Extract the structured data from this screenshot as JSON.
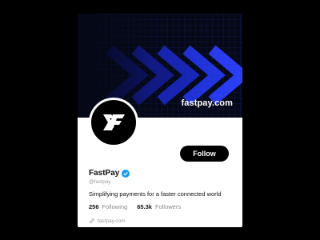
{
  "colors": {
    "page_bg": "#000000",
    "banner_bg": "#050816",
    "arrow_blue": "#2b3fff",
    "verified_blue": "#1d9bf0",
    "button_bg": "#000000",
    "text_muted": "#9a9a9a"
  },
  "banner": {
    "url_text": "fastpay.com",
    "decoration": "arrows-icon"
  },
  "avatar": {
    "icon": "fastpay-logo-icon"
  },
  "profile": {
    "name": "FastPay",
    "verified_icon": "verified-badge-icon",
    "handle": "@fastpay",
    "bio": "Simplifying payments for a faster connected world",
    "link_icon": "link-icon",
    "link_text": "fastpay.com"
  },
  "stats": {
    "following_count": "256",
    "following_label": "Following",
    "followers_count": "65.3k",
    "followers_label": "Followers"
  },
  "actions": {
    "follow_label": "Follow"
  }
}
